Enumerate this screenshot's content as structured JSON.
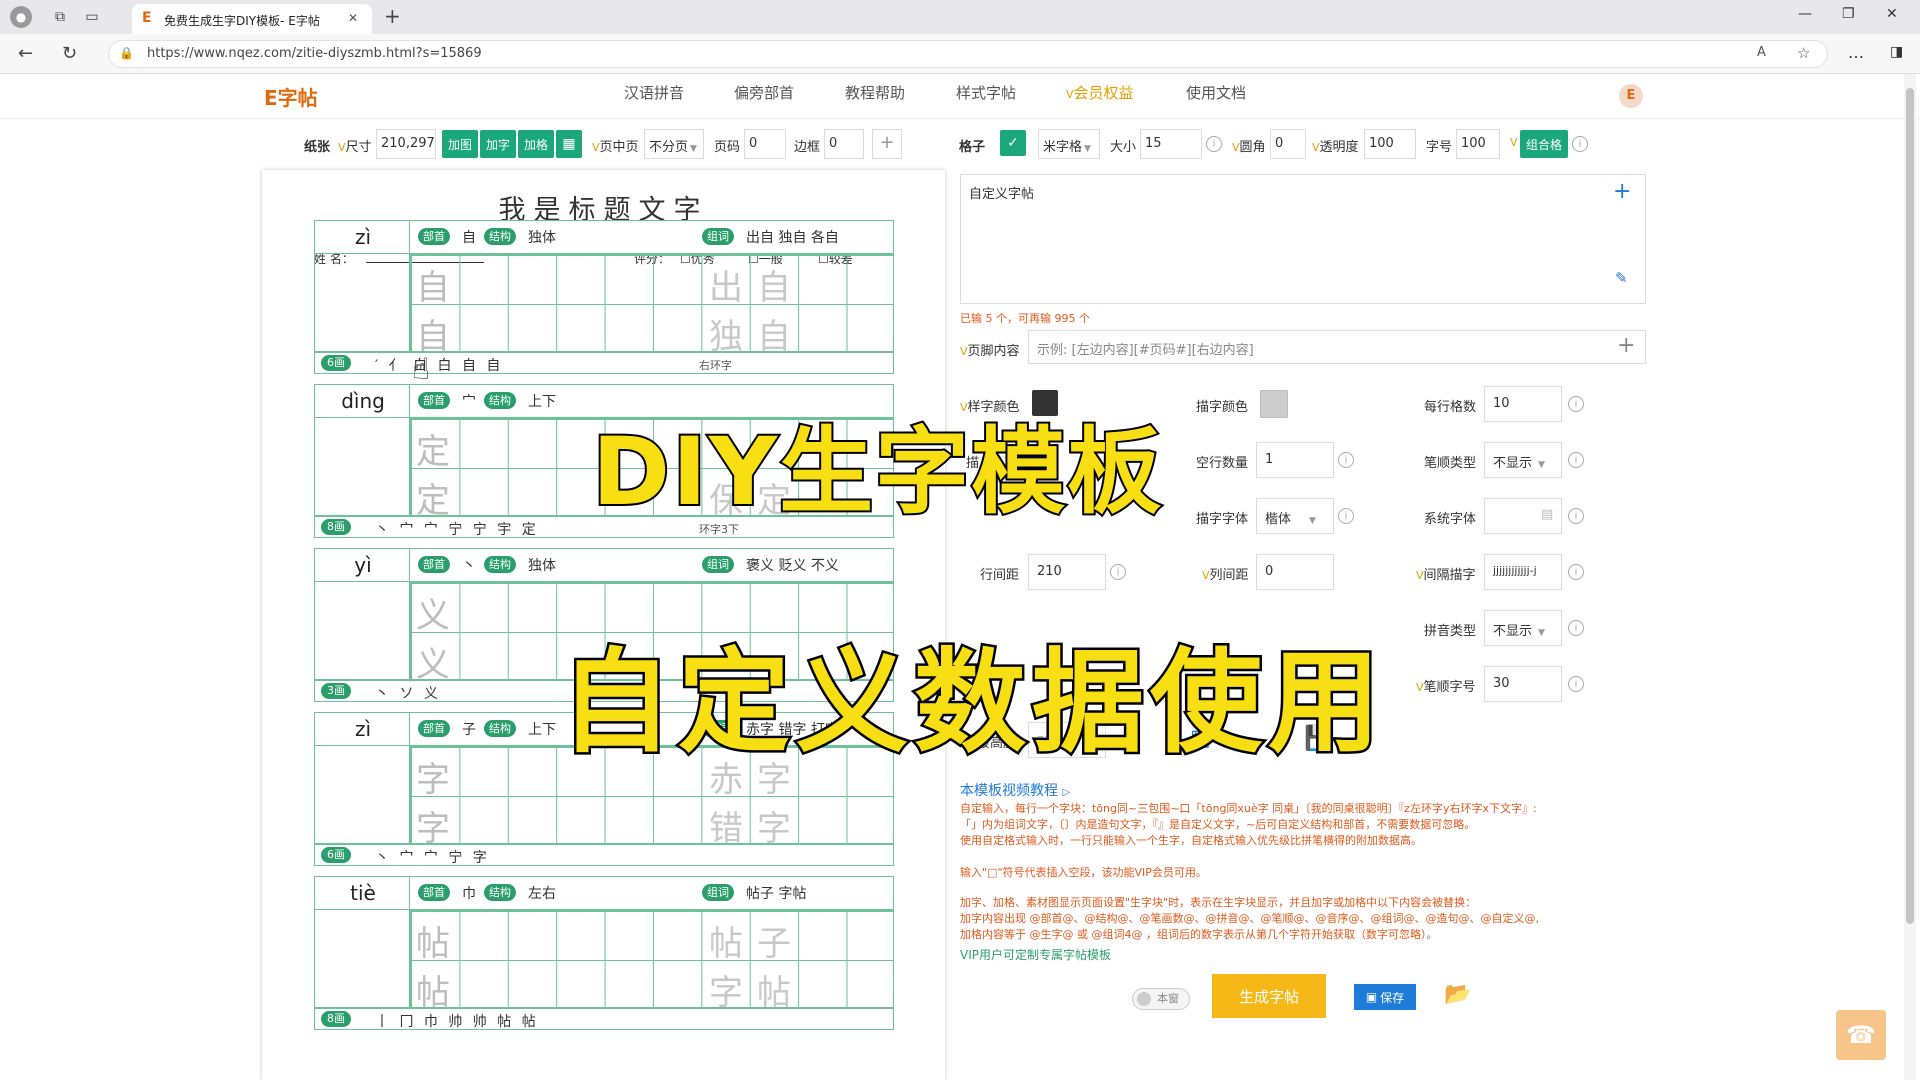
{
  "browser": {
    "tab_title": "免费生成生字DIY模板- E字帖",
    "url": "https://www.nqez.com/zitie-diyszmb.html?s=15869",
    "new_tab": "+",
    "tab_close": "✕"
  },
  "site": {
    "logo": "E字帖",
    "nav": [
      "汉语拼音",
      "偏旁部首",
      "教程帮助",
      "样式字帖",
      "会员权益",
      "使用文档"
    ],
    "avatar": "E"
  },
  "toolbar_left": {
    "paper_label": "纸张",
    "size_label": "尺寸",
    "size_value": "210,297",
    "btn_add_image": "加图",
    "btn_add_char": "加字",
    "btn_add_grid": "加格",
    "page_center_label": "页中页",
    "page_center_value": "不分页",
    "page_num_label": "页码",
    "page_num_value": "0",
    "border_label": "边框",
    "border_value": "0"
  },
  "toolbar_right": {
    "grid_label": "格子",
    "grid_type": "米字格",
    "size_label": "大小",
    "size_value": "15",
    "radius_label": "圆角",
    "radius_value": "0",
    "opacity_label": "透明度",
    "opacity_value": "100",
    "font_size_label": "字号",
    "font_size_value": "100",
    "combo_btn": "组合格"
  },
  "editor": {
    "content": "自定义字帖",
    "count_note": "已输 5 个，可再输 995 个",
    "footer_label": "页脚内容",
    "footer_placeholder": "示例: [左边内容][#页码#][右边内容]"
  },
  "settings": {
    "style_color_label": "样字颜色",
    "trace_color_label": "描字颜色",
    "per_row_label": "每行格数",
    "per_row_value": "10",
    "trace_label": "描",
    "empty_rows_label": "空行数量",
    "empty_rows_value": "1",
    "stroke_type_label": "笔顺类型",
    "stroke_type_value": "不显示",
    "trace_font_label": "描字字体",
    "trace_font_value": "楷体",
    "sys_font_label": "系统字体",
    "line_spacing_label": "行间距",
    "line_spacing_value": "210",
    "col_spacing_label": "列间距",
    "col_spacing_value": "0",
    "interval_label": "间隔描字",
    "interval_value": "jjjjjjjjjjjj-j",
    "pinyin_type_label": "拼音类型",
    "pinyin_type_value": "不显示",
    "stroke_size_label": "笔顺字号",
    "stroke_size_value": "30",
    "empty_height_label": "空段高度",
    "empty_height_value": "默认"
  },
  "help": {
    "video_link": "本模板视频教程",
    "lines": [
      "自定输入，每行一个字块：tōng同~三包围~口「tōng同xuè字 同桌」〔我的同桌很聪明〕『z左环字y右环字x下文字』:",
      "「」内为组词文字，〔〕内是造句文字，『』是自定义文字，~后可自定义结构和部首，不需要数据可忽略。",
      "使用自定格式输入时，一行只能输入一个生字，自定格式输入优先级比拼笔横得的附加数据高。",
      "输入\"□\"符号代表插入空段，该功能VIP会员可用。",
      "加字、加格、素材图显示页面设置\"生字块\"时，表示在生字块显示，并且加字或加格中以下内容会被替换：",
      "加字内容出现 @部首@、@结构@、@笔画数@、@拼音@、@笔顺@、@音序@、@组词@、@造句@、@自定义@,",
      "加格内容等于 @生字@ 或 @组词4@ ，组词后的数字表示从第几个字符开始获取（数字可忽略）。"
    ],
    "vip_link": "VIP用户可定制专属字帖模板"
  },
  "actions": {
    "toggle_label": "本窗",
    "generate": "生成字帖",
    "save": "保存"
  },
  "overlay": {
    "line1": "DIY生字模板",
    "line2": "自定义数据使用"
  },
  "paper": {
    "title": "我是标题文字",
    "name_label": "姓 名：",
    "rating_label": "评分：",
    "rating_options": [
      "优秀",
      "一般",
      "较差"
    ],
    "bushou_tag": "部首",
    "jiegou_tag": "结构",
    "zuci_tag": "组词",
    "blocks": [
      {
        "pinyin": "zì",
        "bushou": "自",
        "jiegou": "独体",
        "words": "出自 独自 各自",
        "char": "自",
        "w1": "出",
        "w2": "自",
        "w3": "独",
        "w4": "自",
        "strokes": "6画",
        "seq": "′ 亻 白 白 自 自",
        "note": "右环字"
      },
      {
        "pinyin": "dìng",
        "bushou": "宀",
        "jiegou": "上下",
        "words": "",
        "char": "定",
        "w1": "",
        "w2": "",
        "w3": "保",
        "w4": "定",
        "strokes": "8画",
        "seq": "丶 宀 宀 宁 宁 宇 定",
        "note": "环字3下"
      },
      {
        "pinyin": "yì",
        "bushou": "丶",
        "jiegou": "独体",
        "words": "褒义 贬义 不义",
        "char": "义",
        "w1": "",
        "w2": "",
        "w3": "",
        "w4": "",
        "strokes": "3画",
        "seq": "丶 ソ 义",
        "note": ""
      },
      {
        "pinyin": "zì",
        "bushou": "子",
        "jiegou": "上下",
        "words": "赤字 错字 打字",
        "char": "字",
        "w1": "赤",
        "w2": "字",
        "w3": "错",
        "w4": "字",
        "strokes": "6画",
        "seq": "丶 宀 宀 宁 字",
        "note": ""
      },
      {
        "pinyin": "tiè",
        "bushou": "巾",
        "jiegou": "左右",
        "words": "帖子 字帖",
        "char": "帖",
        "w1": "帖",
        "w2": "子",
        "w3": "字",
        "w4": "帖",
        "strokes": "8画",
        "seq": "丨 冂 巾 帅 帅 帖 帖",
        "note": ""
      }
    ]
  },
  "colors": {
    "accent": "#1aa87a",
    "grid": "#6cc39a",
    "vip": "#e5a000",
    "note": "#e05a1a",
    "generate": "#f5b817",
    "save": "#1e7bd8"
  }
}
